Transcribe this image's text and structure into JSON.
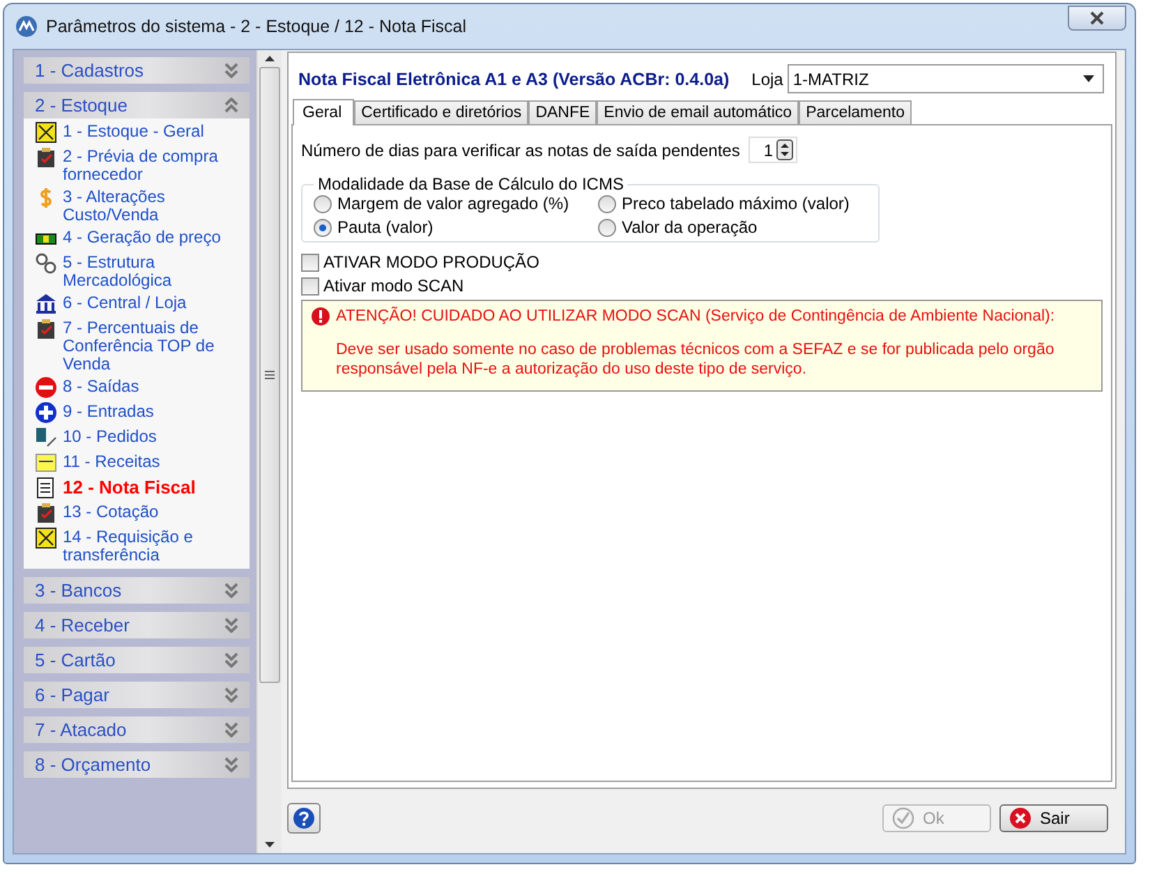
{
  "window": {
    "title": "Parâmetros do sistema - 2 - Estoque / 12 - Nota Fiscal"
  },
  "sidebar": {
    "groups": [
      {
        "label": "1 - Cadastros",
        "expanded": false
      },
      {
        "label": "2 - Estoque",
        "expanded": true,
        "items": [
          {
            "label": "1 - Estoque - Geral",
            "selected": false
          },
          {
            "label": "2 - Prévia de compra fornecedor",
            "selected": false
          },
          {
            "label": "3 - Alterações Custo/Venda",
            "selected": false
          },
          {
            "label": "4 - Geração de preço",
            "selected": false
          },
          {
            "label": "5 - Estrutura Mercadológica",
            "selected": false
          },
          {
            "label": "6 - Central / Loja",
            "selected": false
          },
          {
            "label": "7 - Percentuais de Conferência TOP de Venda",
            "selected": false
          },
          {
            "label": "8 - Saídas",
            "selected": false
          },
          {
            "label": "9 - Entradas",
            "selected": false
          },
          {
            "label": "10 - Pedidos",
            "selected": false
          },
          {
            "label": "11 - Receitas",
            "selected": false
          },
          {
            "label": "12 - Nota Fiscal",
            "selected": true
          },
          {
            "label": "13 - Cotação",
            "selected": false
          },
          {
            "label": "14 - Requisição e transferência",
            "selected": false
          }
        ]
      },
      {
        "label": "3 - Bancos",
        "expanded": false
      },
      {
        "label": "4 - Receber",
        "expanded": false
      },
      {
        "label": "5 - Cartão",
        "expanded": false
      },
      {
        "label": "6 - Pagar",
        "expanded": false
      },
      {
        "label": "7 - Atacado",
        "expanded": false
      },
      {
        "label": "8 - Orçamento",
        "expanded": false
      }
    ]
  },
  "panel": {
    "title": "Nota Fiscal Eletrônica A1 e A3 (Versão ACBr: 0.4.0a)",
    "store_label": "Loja",
    "store_value": "1-MATRIZ",
    "tabs": [
      {
        "label": "Geral",
        "selected": true
      },
      {
        "label": "Certificado e diretórios",
        "selected": false
      },
      {
        "label": "DANFE",
        "selected": false
      },
      {
        "label": "Envio de email automático",
        "selected": false
      },
      {
        "label": "Parcelamento",
        "selected": false
      }
    ],
    "pending_days": {
      "label": "Número de dias para verificar as notas de saída pendentes",
      "value": "1"
    },
    "icms_group": {
      "title": "Modalidade da Base de Cálculo do ICMS",
      "options": [
        {
          "label": "Margem de valor agregado (%)",
          "selected": false
        },
        {
          "label": "Preco tabelado máximo (valor)",
          "selected": false
        },
        {
          "label": "Pauta (valor)",
          "selected": true
        },
        {
          "label": "Valor da operação",
          "selected": false
        }
      ]
    },
    "checkboxes": [
      {
        "label": "ATIVAR MODO PRODUÇÃO",
        "checked": false
      },
      {
        "label": "Ativar modo SCAN",
        "checked": false
      }
    ],
    "warning": {
      "title": "ATENÇÃO! CUIDADO AO UTILIZAR MODO SCAN (Serviço de Contingência de Ambiente Nacional):",
      "text": "Deve ser usado somente no caso de problemas técnicos com a SEFAZ e se for publicada pelo orgão responsável pela NF-e a autorização do uso deste tipo de serviço."
    }
  },
  "buttons": [
    {
      "label": "Ok",
      "disabled": true
    },
    {
      "label": "Sair",
      "disabled": false
    }
  ]
}
